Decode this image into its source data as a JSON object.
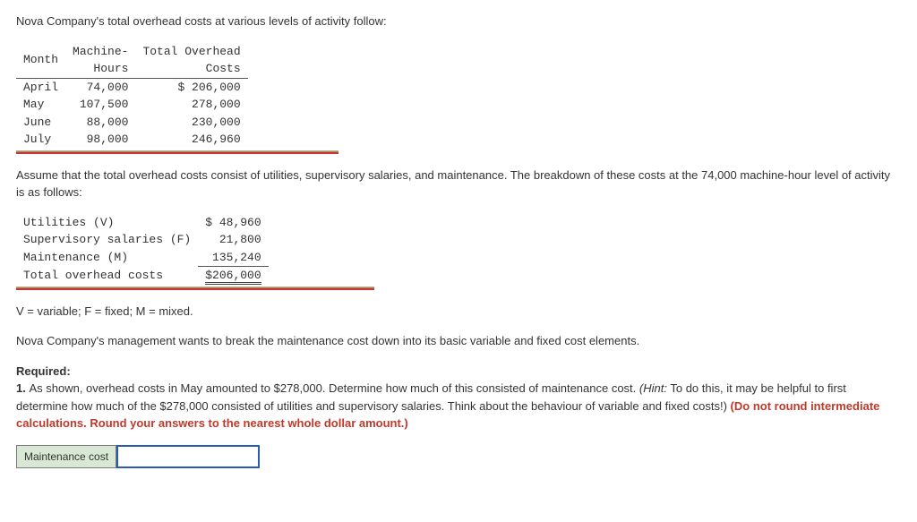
{
  "intro": "Nova Company's total overhead costs at various levels of activity follow:",
  "table1": {
    "head": {
      "c0": "Month",
      "c1": "Machine-\nHours",
      "c2": "Total Overhead\nCosts"
    },
    "rows": [
      {
        "month": "April",
        "hours": "74,000",
        "costs": "$ 206,000"
      },
      {
        "month": "May",
        "hours": "107,500",
        "costs": "278,000"
      },
      {
        "month": "June",
        "hours": "88,000",
        "costs": "230,000"
      },
      {
        "month": "July",
        "hours": "98,000",
        "costs": "246,960"
      }
    ]
  },
  "para2": "Assume that the total overhead costs consist of utilities, supervisory salaries, and maintenance. The breakdown of these costs at the 74,000 machine-hour level of activity is as follows:",
  "table2": {
    "rows": [
      {
        "label": "Utilities (V)",
        "value": "$ 48,960"
      },
      {
        "label": "Supervisory salaries (F)",
        "value": "21,800"
      },
      {
        "label": "Maintenance (M)",
        "value": "135,240"
      }
    ],
    "total": {
      "label": "Total overhead costs",
      "value": "$206,000"
    }
  },
  "legend": "V = variable; F = fixed; M = mixed.",
  "para3": "Nova Company's management wants to break the maintenance cost down into its basic variable and fixed cost elements.",
  "required": {
    "heading": "Required:",
    "item_prefix": "1. ",
    "item_body": "As shown, overhead costs in May amounted to $278,000. Determine how much of this consisted of maintenance cost. ",
    "hint_prefix": "(Hint:",
    "hint_body": " To do this, it may be helpful to first determine how much of the $278,000 consisted of utilities and supervisory salaries. Think about the behaviour of variable and fixed costs!) ",
    "red": "(Do not round intermediate calculations. Round your answers to the nearest whole dollar amount.)"
  },
  "answer": {
    "label": "Maintenance cost",
    "value": ""
  }
}
